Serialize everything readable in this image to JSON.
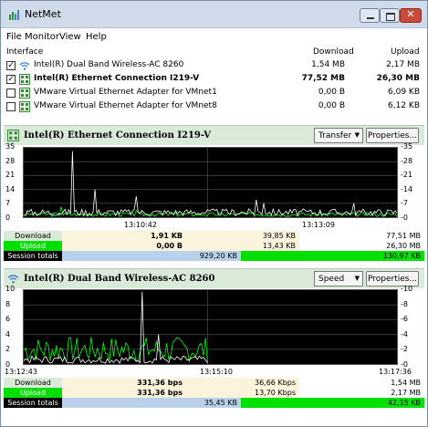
{
  "window": {
    "title": "NetMet"
  },
  "menu": [
    "File",
    "Monitor",
    "View",
    "Help"
  ],
  "table": {
    "headers": {
      "interface": "Interface",
      "download": "Download",
      "upload": "Upload"
    },
    "rows": [
      {
        "checked": true,
        "icon": "wifi-icon",
        "name": "Intel(R) Dual Band Wireless-AC 8260",
        "download": "1,54 MB",
        "upload": "2,17 MB",
        "bold": false
      },
      {
        "checked": true,
        "icon": "ethernet-icon",
        "name": "Intel(R) Ethernet Connection I219-V",
        "download": "77,52 MB",
        "upload": "26,30 MB",
        "bold": true
      },
      {
        "checked": false,
        "icon": "ethernet-icon",
        "name": "VMware Virtual Ethernet Adapter for VMnet1",
        "download": "0,00 B",
        "upload": "6,09 KB",
        "bold": false
      },
      {
        "checked": false,
        "icon": "ethernet-icon",
        "name": "VMware Virtual Ethernet Adapter for VMnet8",
        "download": "0,00 B",
        "upload": "6,12 KB",
        "bold": false
      }
    ]
  },
  "panels": [
    {
      "title": "Intel(R) Ethernet Connection I219-V",
      "icon": "ethernet-icon",
      "mode": "Transfer",
      "properties": "Properties...",
      "yticks": [
        "35",
        "28",
        "21",
        "14",
        "7",
        "0"
      ],
      "times": [
        "13:10:42",
        "13:13:09"
      ],
      "stats": {
        "download_label": "Download",
        "upload_label": "Upload",
        "totals_label": "Session totals",
        "dl": [
          "1,91 KB",
          "39,85 KB",
          "77,51 MB"
        ],
        "ul": [
          "0,00 B",
          "13,43 KB",
          "26,30 MB"
        ],
        "totals": [
          "929,20 KB",
          "130,97 KB"
        ]
      }
    },
    {
      "title": "Intel(R) Dual Band Wireless-AC 8260",
      "icon": "wifi-icon",
      "mode": "Speed",
      "properties": "Properties...",
      "yticks": [
        "10",
        "8",
        "6",
        "4",
        "2",
        "0"
      ],
      "times": [
        "13:12:43",
        "13:15:10",
        "13:17:36"
      ],
      "stats": {
        "download_label": "Download",
        "upload_label": "Upload",
        "totals_label": "Session totals",
        "dl": [
          "331,36 bps",
          "36,66 Kbps",
          "1,54 MB"
        ],
        "ul": [
          "331,36 bps",
          "13,70 Kbps",
          "2,17 MB"
        ],
        "totals": [
          "35,45 KB",
          "42,15 KB"
        ]
      }
    }
  ],
  "colors": {
    "download": "#ffffff",
    "upload": "#00ff00",
    "grid": "#3a3a3a",
    "panelHead": "#d9ead9"
  }
}
